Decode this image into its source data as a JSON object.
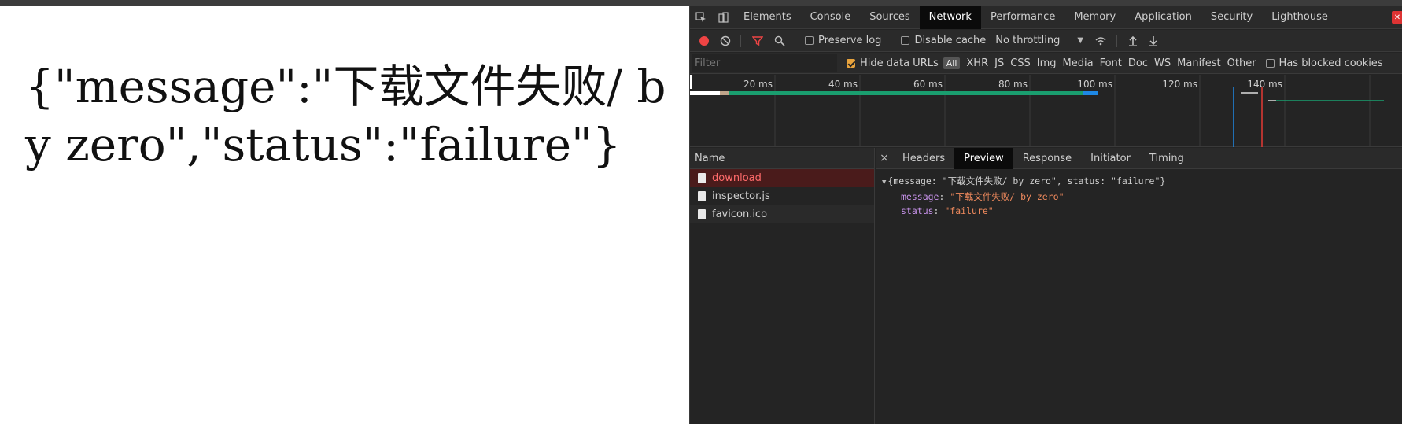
{
  "page": {
    "json_text": "{\"message\":\"下载文件失败/ by zero\",\"status\":\"failure\"}"
  },
  "devtools": {
    "tabs": [
      "Elements",
      "Console",
      "Sources",
      "Network",
      "Performance",
      "Memory",
      "Application",
      "Security",
      "Lighthouse"
    ],
    "active_tab": "Network",
    "toolbar": {
      "preserve_log": "Preserve log",
      "disable_cache": "Disable cache",
      "throttling": "No throttling"
    },
    "filterbar": {
      "filter_placeholder": "Filter",
      "hide_data_urls": "Hide data URLs",
      "all": "All",
      "types": [
        "XHR",
        "JS",
        "CSS",
        "Img",
        "Media",
        "Font",
        "Doc",
        "WS",
        "Manifest",
        "Other"
      ],
      "has_blocked_cookies": "Has blocked cookies"
    },
    "timeline": {
      "ticks": [
        "20 ms",
        "40 ms",
        "60 ms",
        "80 ms",
        "100 ms",
        "120 ms",
        "140 ms"
      ]
    },
    "requests": {
      "header": "Name",
      "items": [
        "download",
        "inspector.js",
        "favicon.ico"
      ]
    },
    "detail": {
      "tabs": [
        "Headers",
        "Preview",
        "Response",
        "Initiator",
        "Timing"
      ],
      "active_tab": "Preview",
      "preview": {
        "summary": "{message: \"下载文件失败/ by zero\", status: \"failure\"}",
        "message_key": "message",
        "message_value": "\"下载文件失败/ by zero\"",
        "status_key": "status",
        "status_value": "\"failure\""
      }
    }
  },
  "colors": {
    "accent_active_tab": "#0b0b0b",
    "error_row": "#ff6b6b",
    "key": "#c792ea",
    "string": "#f08a5d",
    "bar_green": "#1a9e6f",
    "bar_blue": "#1e88e5"
  }
}
